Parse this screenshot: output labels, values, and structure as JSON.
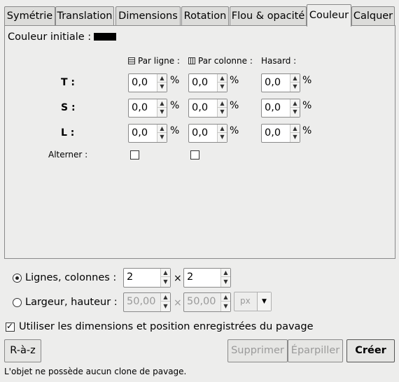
{
  "tabs": [
    {
      "label": "Symétrie",
      "active": false
    },
    {
      "label": "Translation",
      "active": false
    },
    {
      "label": "Dimensions",
      "active": false
    },
    {
      "label": "Rotation",
      "active": false
    },
    {
      "label": "Flou & opacité",
      "active": false
    },
    {
      "label": "Couleur",
      "active": true
    },
    {
      "label": "Calquer",
      "active": false
    }
  ],
  "color": {
    "initial_label": "Couleur initiale :",
    "initial_swatch": "#000000",
    "columns": {
      "per_row": "Par ligne :",
      "per_column": "Par colonne :",
      "random": "Hasard :"
    },
    "rows": [
      {
        "label": "T :",
        "per_row": "0,0",
        "per_column": "0,0",
        "random": "0,0"
      },
      {
        "label": "S :",
        "per_row": "0,0",
        "per_column": "0,0",
        "random": "0,0"
      },
      {
        "label": "L :",
        "per_row": "0,0",
        "per_column": "0,0",
        "random": "0,0"
      }
    ],
    "percent": "%",
    "alternate_label": "Alterner :",
    "alternate_per_row": false,
    "alternate_per_column": false
  },
  "layout": {
    "rows_cols_label": "Lignes, colonnes :",
    "rows_value": "2",
    "cols_value": "2",
    "times": "×",
    "width_height_label": "Largeur, hauteur :",
    "width_value": "50,00",
    "height_value": "50,00",
    "unit": "px",
    "selected": "rows_cols"
  },
  "use_saved_label": "Utiliser les dimensions et position enregistrées du pavage",
  "use_saved_checked": true,
  "buttons": {
    "reset": "R-à-z",
    "delete": "Supprimer",
    "scatter": "Éparpiller",
    "create": "Créer"
  },
  "status": "L'objet ne possède aucun clone de pavage."
}
